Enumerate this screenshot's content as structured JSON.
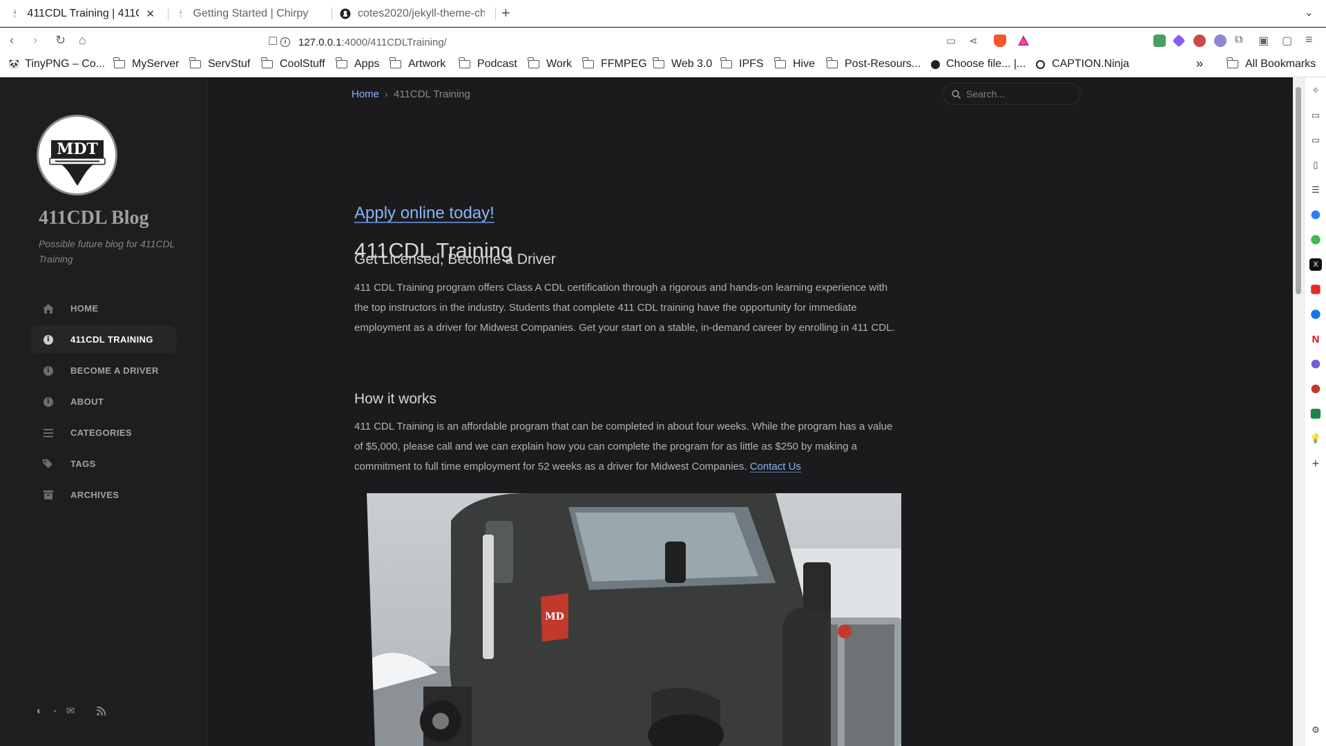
{
  "browser": {
    "tabs": [
      {
        "title": "411CDL Training | 411CDL",
        "active": true
      },
      {
        "title": "Getting Started | Chirpy",
        "active": false
      },
      {
        "title": "cotes2020/jekyll-theme-chirpy",
        "active": false
      }
    ],
    "url_host": "127.0.0.1",
    "url_path": ":4000/411CDLTraining/",
    "bookmarks": [
      {
        "label": "TinyPNG – Co...",
        "type": "site"
      },
      {
        "label": "MyServer",
        "type": "folder"
      },
      {
        "label": "ServStuf",
        "type": "folder"
      },
      {
        "label": "CoolStuff",
        "type": "folder"
      },
      {
        "label": "Apps",
        "type": "folder"
      },
      {
        "label": "Artwork",
        "type": "folder"
      },
      {
        "label": "Podcast",
        "type": "folder"
      },
      {
        "label": "Work",
        "type": "folder"
      },
      {
        "label": "FFMPEG",
        "type": "folder"
      },
      {
        "label": "Web 3.0",
        "type": "folder"
      },
      {
        "label": "IPFS",
        "type": "folder"
      },
      {
        "label": "Hive",
        "type": "folder"
      },
      {
        "label": "Post-Resours...",
        "type": "folder"
      },
      {
        "label": "Choose file... |...",
        "type": "site"
      },
      {
        "label": "CAPTION.Ninja",
        "type": "site"
      }
    ],
    "overflow_label": "»",
    "all_bookmarks": "All Bookmarks"
  },
  "site": {
    "title": "411CDL Blog",
    "subtitle": "Possible future blog for 411CDL Training",
    "nav": [
      {
        "label": "HOME",
        "icon": "home-icon",
        "active": false
      },
      {
        "label": "411CDL TRAINING",
        "icon": "info-icon",
        "active": true
      },
      {
        "label": "BECOME A DRIVER",
        "icon": "info-icon",
        "active": false
      },
      {
        "label": "ABOUT",
        "icon": "info-icon",
        "active": false
      },
      {
        "label": "CATEGORIES",
        "icon": "stream-icon",
        "active": false
      },
      {
        "label": "TAGS",
        "icon": "tags-icon",
        "active": false
      },
      {
        "label": "ARCHIVES",
        "icon": "archive-icon",
        "active": false
      }
    ]
  },
  "breadcrumb": {
    "home": "Home",
    "current": "411CDL Training"
  },
  "search": {
    "placeholder": "Search..."
  },
  "post": {
    "title": "411CDL Training",
    "apply_link": "Apply online today!",
    "section1_heading": "Get Licensed, Become a Driver",
    "section1_body": "411 CDL Training program offers Class A CDL certification through a rigorous and hands-on learning experience with the top instructors in the industry. Students that complete 411 CDL training have the opportunity for immediate employment as a driver for Midwest Companies. Get your start on a stable, in-demand career by enrolling in 411 CDL.",
    "section2_heading": "How it works",
    "section2_body": "411 CDL Training is an affordable program that can be completed in about four weeks. While the program has a value of $5,000, please call and we can explain how you can complete the program for as little as $250 by making a commitment to full time employment for 52 weeks as a driver for Midwest Companies.",
    "contact_link": "Contact Us"
  },
  "colors": {
    "accent": "#8ab4f8",
    "page_bg": "#1b1b1e",
    "sidebar_bg": "#1e1e1e"
  }
}
